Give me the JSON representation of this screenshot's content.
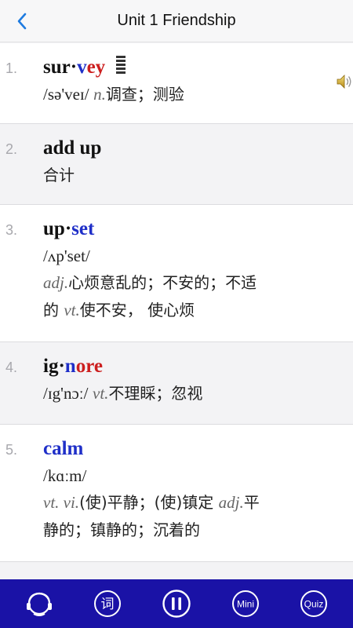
{
  "header": {
    "title": "Unit 1 Friendship"
  },
  "entries": [
    {
      "num": "1.",
      "parts": [
        [
          "sur",
          ""
        ],
        [
          "·",
          ""
        ],
        [
          "v",
          "blue"
        ],
        [
          "ey",
          "red"
        ]
      ],
      "phonetic": "/sə'veɪ/",
      "lines": [
        [
          [
            "pos",
            "n."
          ],
          [
            "def",
            "调查；测验"
          ]
        ]
      ]
    },
    {
      "num": "2.",
      "parts": [
        [
          "add up",
          ""
        ]
      ],
      "phonetic": "",
      "lines": [
        [
          [
            "def",
            "合计"
          ]
        ]
      ]
    },
    {
      "num": "3.",
      "parts": [
        [
          "up",
          ""
        ],
        [
          "·",
          ""
        ],
        [
          "set",
          "blue"
        ]
      ],
      "phonetic": "/ʌp'set/",
      "lines": [
        [
          [
            "pos",
            "adj."
          ],
          [
            "def",
            "心烦意乱的；不安的；不适"
          ]
        ],
        [
          [
            "def",
            "的 "
          ],
          [
            "pos",
            "vt."
          ],
          [
            "def",
            "使不安， 使心烦"
          ]
        ]
      ]
    },
    {
      "num": "4.",
      "parts": [
        [
          "ig",
          ""
        ],
        [
          "·",
          ""
        ],
        [
          "n",
          "blue"
        ],
        [
          "ore",
          "red"
        ]
      ],
      "phonetic": "/ɪg'nɔː/",
      "lines": [
        [
          [
            "pos",
            "vt."
          ],
          [
            "def",
            "不理睬；忽视"
          ]
        ]
      ]
    },
    {
      "num": "5.",
      "parts": [
        [
          "calm",
          "blue"
        ]
      ],
      "phonetic": "/kɑːm/",
      "lines": [
        [
          [
            "pos",
            "vt. vi."
          ],
          [
            "def",
            "(使)平静；(使)镇定 "
          ],
          [
            "pos",
            "adj."
          ],
          [
            "def",
            "平"
          ]
        ],
        [
          [
            "def",
            "静的；镇静的；沉着的"
          ]
        ]
      ]
    }
  ],
  "bottom_nav": {
    "mini_label": "Mini",
    "quiz_label": "Quiz",
    "word_label": "词"
  },
  "colors": {
    "accent": "#1a12a6",
    "blue": "#1f2fc8",
    "red": "#cc1f1f",
    "back": "#1e7be0"
  }
}
